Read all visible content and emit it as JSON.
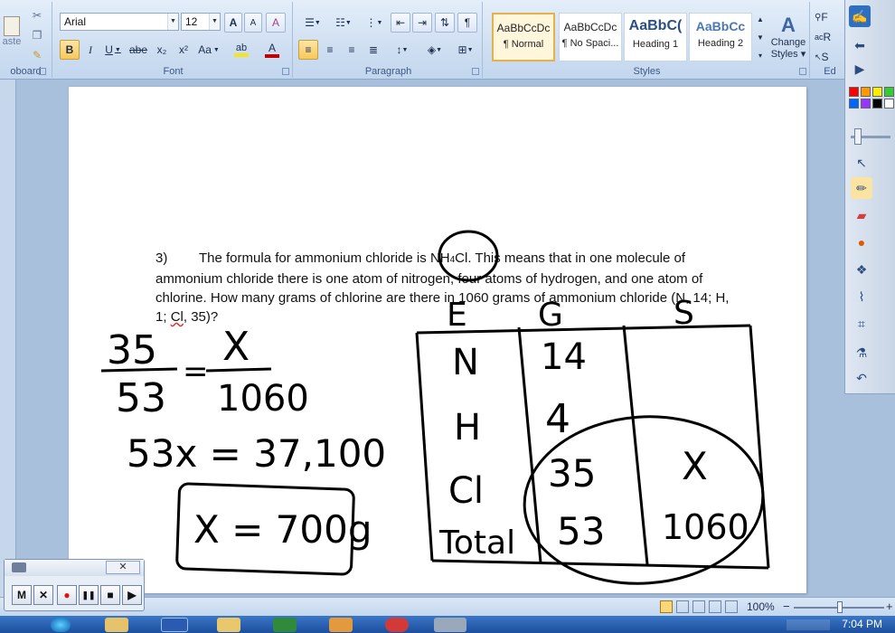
{
  "ribbon": {
    "clipboard": {
      "paste_label": "aste",
      "group_label": "oboard"
    },
    "font": {
      "font_name": "Arial",
      "font_size": "12",
      "group_label": "Font",
      "bold": "B",
      "italic": "I",
      "underline": "U",
      "strike": "abe",
      "subscript": "x₂",
      "superscript": "x²",
      "change_case": "Aa",
      "grow": "A",
      "shrink": "A",
      "clear": "A",
      "highlight_color": "#f5e61a",
      "font_color": "#c00000"
    },
    "paragraph": {
      "group_label": "Paragraph",
      "pilcrow": "¶"
    },
    "styles": {
      "group_label": "Styles",
      "items": [
        {
          "sample": "AaBbCcDc",
          "name": "¶ Normal"
        },
        {
          "sample": "AaBbCcDc",
          "name": "¶ No Spaci..."
        },
        {
          "sample": "AaBbC(",
          "name": "Heading 1"
        },
        {
          "sample": "AaBbCc",
          "name": "Heading 2"
        }
      ],
      "change_styles_line1": "Change",
      "change_styles_line2": "Styles ▾"
    },
    "editing": {
      "group_label": "Ed",
      "find_label": "F",
      "replace_label": "R",
      "select_label": "S"
    }
  },
  "document": {
    "question_number": "3)",
    "text_before_formula": "The formula for ammonium chloride is ",
    "formula_main": "NH",
    "formula_sub": "4",
    "formula_end": "Cl",
    "text_after_formula": ". This means that in one molecule of ammonium chloride there is one atom of nitrogen, four atoms of hydrogen, and one atom of chlorine. How many grams of chlorine are there in 1060 grams of ammonium chloride (N, 14; H, 1; ",
    "squiggly_word": "Cl",
    "text_end": ", 35)?"
  },
  "handwriting": {
    "frac1_num": "35",
    "frac1_den": "53",
    "equals": "=",
    "frac2_num": "X",
    "frac2_den": "1060",
    "equation": "53x = 37,100",
    "answer": "X = 700g",
    "table_headers": [
      "E",
      "G",
      "S"
    ],
    "table_rows": [
      {
        "e": "N",
        "g": "14",
        "s": ""
      },
      {
        "e": "H",
        "g": "4",
        "s": ""
      },
      {
        "e": "Cl",
        "g": "35",
        "s": "X"
      },
      {
        "e": "Total",
        "g": "53",
        "s": "1060"
      }
    ]
  },
  "statusbar": {
    "zoom": "100%",
    "zoom_minus": "−",
    "zoom_plus": "+"
  },
  "taskbar": {
    "clock": "7:04 PM"
  },
  "recorder": {
    "buttons": [
      "M",
      "✕",
      "●",
      "❚❚",
      "■",
      "▶"
    ],
    "close_label": "✕"
  },
  "palette": {
    "colors": [
      "#ff0000",
      "#ff9900",
      "#ffee00",
      "#33cc33",
      "#0066ff",
      "#9933ff",
      "#ff33cc",
      "#000000",
      "#ffffff",
      "#0033cc",
      "#00aa00",
      "#ffffff"
    ]
  }
}
